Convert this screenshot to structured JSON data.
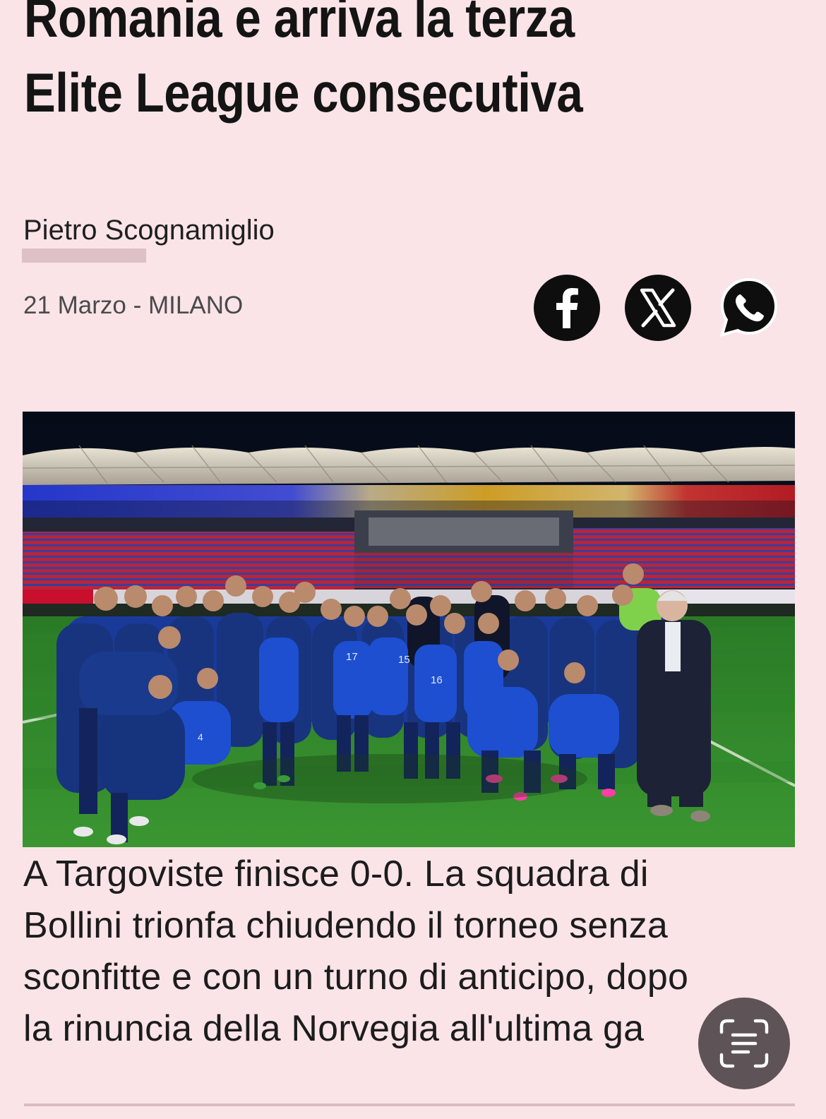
{
  "article": {
    "headline": {
      "line1": "Romania e arriva la terza",
      "line2": "Elite League consecutiva"
    },
    "author": "Pietro Scognamiglio",
    "dateline": "21 Marzo - MILANO",
    "lead": {
      "line1": "A Targoviste finisce 0-0. La squadra di",
      "line2": "Bollini trionfa chiudendo il torneo senza",
      "line3": "sconfitte e con un turno di anticipo, dopo",
      "line4": "la rinuncia della Norvegia all'ultima ga"
    }
  },
  "share": {
    "items": [
      {
        "network": "facebook",
        "icon": "facebook-icon"
      },
      {
        "network": "x",
        "icon": "x-logo-icon"
      },
      {
        "network": "whatsapp",
        "icon": "whatsapp-icon"
      }
    ]
  },
  "photo": {
    "subject": "team-photo",
    "jersey_numbers": [
      "17",
      "15",
      "16",
      "4"
    ]
  },
  "overlay": {
    "icon": "text-scan-icon"
  },
  "colors": {
    "background": "#fae4e8",
    "text": "#161616",
    "muted": "#4a4a4a",
    "author_underline": "#ddc1c7",
    "share_icon_bg": "#0e0e0e",
    "team_kit": "#1d4fd0",
    "pitch": "#2f8a2a"
  }
}
